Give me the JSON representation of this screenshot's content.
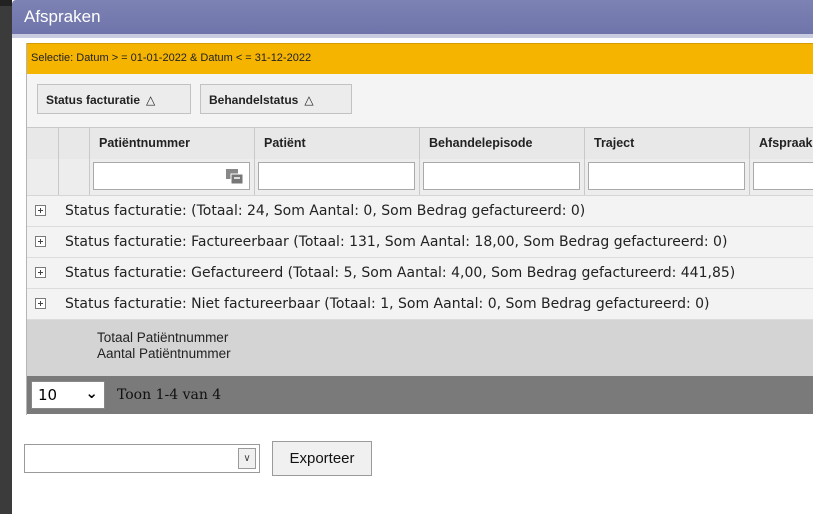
{
  "window": {
    "title": "Afspraken"
  },
  "filter": {
    "text": "Selectie: Datum > = 01-01-2022 & Datum < = 31-12-2022"
  },
  "group_panel": {
    "buttons": [
      {
        "label": "Status facturatie",
        "sort_icon": "△"
      },
      {
        "label": "Behandelstatus",
        "sort_icon": "△"
      }
    ]
  },
  "columns": [
    "Patiëntnummer",
    "Patiënt",
    "Behandelepisode",
    "Traject",
    "Afspraak"
  ],
  "filter_row": {
    "filter_icon": "filter-options-icon"
  },
  "groups": [
    "Status facturatie: (Totaal: 24, Som Aantal: 0, Som Bedrag gefactureerd: 0)",
    "Status facturatie: Factureerbaar (Totaal: 131, Som Aantal: 18,00, Som Bedrag gefactureerd: 0)",
    "Status facturatie: Gefactureerd (Totaal: 5, Som Aantal: 4,00, Som Bedrag gefactureerd: 441,85)",
    "Status facturatie: Niet factureerbaar (Totaal: 1, Som Aantal: 0, Som Bedrag gefactureerd: 0)"
  ],
  "footer": {
    "line1": "Totaal Patiëntnummer",
    "line2": "Aantal Patiëntnummer"
  },
  "pager": {
    "page_size": "10",
    "info": "Toon 1-4 van 4"
  },
  "export": {
    "selected": "",
    "button_label": "Exporteer"
  },
  "colors": {
    "title_bar": "#7478ad",
    "filter_bar": "#f5b400",
    "pager_bar": "#7a7a7a"
  }
}
